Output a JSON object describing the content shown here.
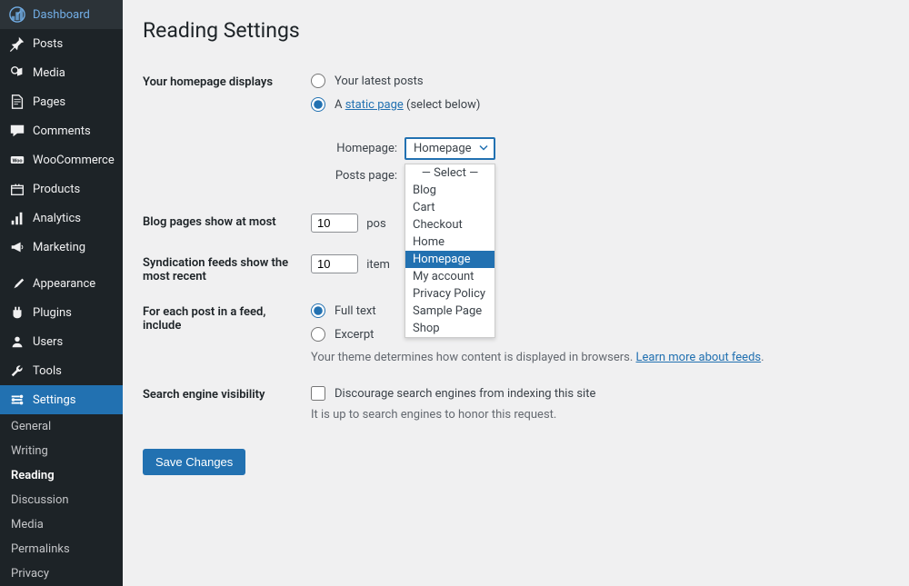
{
  "sidebar": {
    "items": [
      {
        "label": "Dashboard",
        "icon": "dashboard"
      },
      {
        "label": "Posts",
        "icon": "pin"
      },
      {
        "label": "Media",
        "icon": "media"
      },
      {
        "label": "Pages",
        "icon": "pages"
      },
      {
        "label": "Comments",
        "icon": "comments"
      },
      {
        "label": "WooCommerce",
        "icon": "woo"
      },
      {
        "label": "Products",
        "icon": "products"
      },
      {
        "label": "Analytics",
        "icon": "analytics"
      },
      {
        "label": "Marketing",
        "icon": "marketing"
      },
      {
        "label": "Appearance",
        "icon": "appearance"
      },
      {
        "label": "Plugins",
        "icon": "plugins"
      },
      {
        "label": "Users",
        "icon": "users"
      },
      {
        "label": "Tools",
        "icon": "tools"
      },
      {
        "label": "Settings",
        "icon": "settings"
      }
    ],
    "submenu": [
      {
        "label": "General"
      },
      {
        "label": "Writing"
      },
      {
        "label": "Reading"
      },
      {
        "label": "Discussion"
      },
      {
        "label": "Media"
      },
      {
        "label": "Permalinks"
      },
      {
        "label": "Privacy"
      }
    ]
  },
  "page": {
    "title": "Reading Settings",
    "homepage_displays_label": "Your homepage displays",
    "radio_latest": "Your latest posts",
    "radio_static_prefix": "A ",
    "radio_static_link": "static page",
    "radio_static_suffix": " (select below)",
    "homepage_label": "Homepage:",
    "homepage_value": "Homepage",
    "postspage_label": "Posts page:",
    "dropdown_options": [
      {
        "label": "— Select —"
      },
      {
        "label": "Blog"
      },
      {
        "label": "Cart"
      },
      {
        "label": "Checkout"
      },
      {
        "label": "Home"
      },
      {
        "label": "Homepage"
      },
      {
        "label": "My account"
      },
      {
        "label": "Privacy Policy"
      },
      {
        "label": "Sample Page"
      },
      {
        "label": "Shop"
      }
    ],
    "blog_pages_label": "Blog pages show at most",
    "blog_pages_value": "10",
    "blog_pages_suffix": "pos",
    "syndication_label": "Syndication feeds show the most recent",
    "syndication_value": "10",
    "syndication_suffix": "item",
    "each_post_label": "For each post in a feed, include",
    "radio_fulltext": "Full text",
    "radio_excerpt": "Excerpt",
    "feed_desc_prefix": "Your theme determines how content is displayed in browsers. ",
    "feed_desc_link": "Learn more about feeds",
    "feed_desc_suffix": ".",
    "search_label": "Search engine visibility",
    "search_checkbox": "Discourage search engines from indexing this site",
    "search_desc": "It is up to search engines to honor this request.",
    "save_button": "Save Changes"
  }
}
